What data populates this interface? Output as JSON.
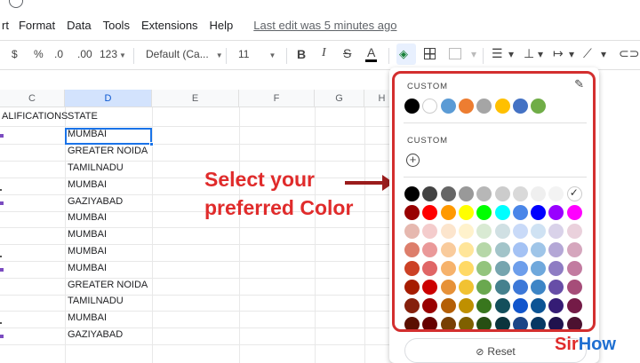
{
  "menu": {
    "items": [
      "rt",
      "Format",
      "Data",
      "Tools",
      "Extensions",
      "Help"
    ],
    "last_edit": "Last edit was 5 minutes ago"
  },
  "toolbar": {
    "currency": "$",
    "percent": "%",
    "dec_decrease": ".0",
    "dec_increase": ".00",
    "number_format": "123",
    "font": "Default (Ca...",
    "font_size": "11",
    "bold": "B",
    "italic": "I",
    "strike": "S",
    "text_color": "A"
  },
  "sheet": {
    "columns": [
      "C",
      "D",
      "E",
      "F",
      "G",
      "H"
    ],
    "header_row": {
      "c": "ALIFICATIONS",
      "d": "STATE"
    },
    "rows": [
      "MUMBAI",
      "GREATER NOIDA",
      "TAMILNADU",
      "MUMBAI",
      "GAZIYABAD",
      "MUMBAI",
      "MUMBAI",
      "MUMBAI",
      "MUMBAI",
      "GREATER NOIDA",
      "TAMILNADU",
      "MUMBAI",
      "GAZIYABAD"
    ]
  },
  "annotation": {
    "line1": "Select your",
    "line2": "preferred Color"
  },
  "palette": {
    "custom_label_1": "CUSTOM",
    "custom_label_2": "CUSTOM",
    "custom_colors": [
      "#000000",
      "#ffffff",
      "#5b9bd5",
      "#ed7d31",
      "#a5a5a5",
      "#ffc000",
      "#4472c4",
      "#70ad47"
    ],
    "grid": [
      [
        "#000000",
        "#434343",
        "#666666",
        "#999999",
        "#b7b7b7",
        "#cccccc",
        "#d9d9d9",
        "#efefef",
        "#f3f3f3",
        "#ffffff"
      ],
      [
        "#980000",
        "#ff0000",
        "#ff9900",
        "#ffff00",
        "#00ff00",
        "#00ffff",
        "#4a86e8",
        "#0000ff",
        "#9900ff",
        "#ff00ff"
      ],
      [
        "#e6b8af",
        "#f4cccc",
        "#fce5cd",
        "#fff2cc",
        "#d9ead3",
        "#d0e0e3",
        "#c9daf8",
        "#cfe2f3",
        "#d9d2e9",
        "#ead1dc"
      ],
      [
        "#dd7e6b",
        "#ea9999",
        "#f9cb9c",
        "#ffe599",
        "#b6d7a8",
        "#a2c4c9",
        "#a4c2f4",
        "#9fc5e8",
        "#b4a7d6",
        "#d5a6bd"
      ],
      [
        "#cc4125",
        "#e06666",
        "#f6b26b",
        "#ffd966",
        "#93c47d",
        "#76a5af",
        "#6d9eeb",
        "#6fa8dc",
        "#8e7cc3",
        "#c27ba0"
      ],
      [
        "#a61c00",
        "#cc0000",
        "#e69138",
        "#f1c232",
        "#6aa84f",
        "#45818e",
        "#3c78d8",
        "#3d85c6",
        "#674ea7",
        "#a64d79"
      ],
      [
        "#85200c",
        "#990000",
        "#b45f06",
        "#bf9000",
        "#38761d",
        "#134f5c",
        "#1155cc",
        "#0b5394",
        "#351c75",
        "#741b47"
      ],
      [
        "#5b0f00",
        "#660000",
        "#783f04",
        "#7f6000",
        "#274e13",
        "#0c343d",
        "#1c4587",
        "#073763",
        "#20124d",
        "#4c1130"
      ]
    ],
    "reset_label": "Reset"
  },
  "brand": {
    "part1": "Sir",
    "part2": "How"
  }
}
